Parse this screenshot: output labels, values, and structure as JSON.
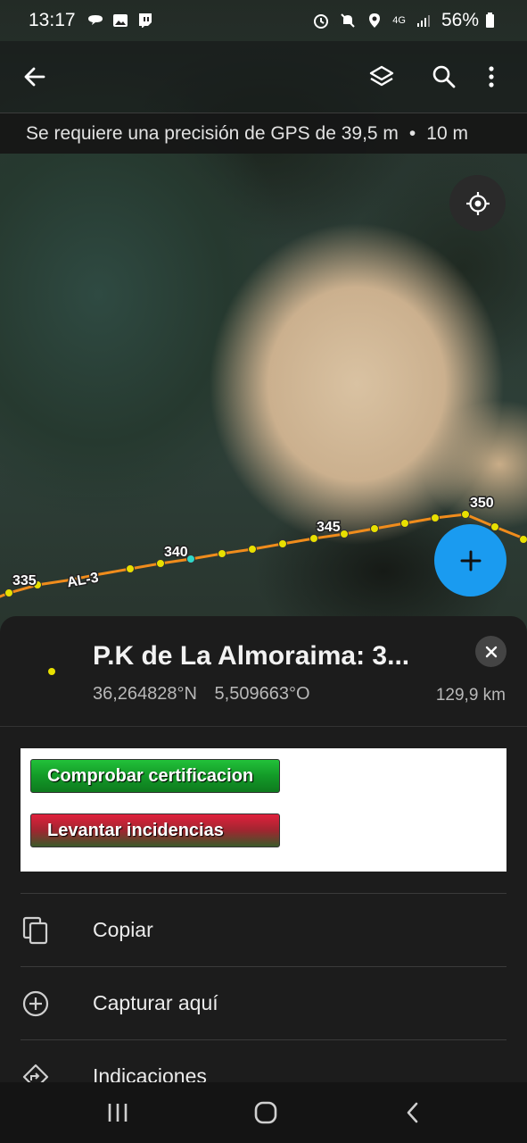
{
  "status_bar": {
    "time": "13:17",
    "battery": "56%",
    "network": "4G",
    "left_icons": [
      "chat-bubble-icon",
      "image-icon",
      "twitch-icon"
    ],
    "right_icons": [
      "alarm-icon",
      "mute-icon",
      "location-icon",
      "network-4g-icon",
      "signal-icon",
      "battery-icon"
    ]
  },
  "toolbar": {
    "icons": [
      "back-arrow-icon",
      "layers-icon",
      "search-icon",
      "more-vert-icon"
    ]
  },
  "gps_banner": {
    "text": "Se requiere una precisión de GPS de 39,5 m",
    "separator": "•",
    "accuracy": "10 m"
  },
  "map": {
    "route_label": "AL-3",
    "km_labels": [
      "335",
      "340",
      "345",
      "350"
    ],
    "route_color": "#f08c1c",
    "point_color": "#e8e000",
    "fab_color": "#1a9bf0"
  },
  "sheet": {
    "title": "P.K de La Almoraima: 3...",
    "latitude": "36,264828°N",
    "longitude": "5,509663°O",
    "distance": "129,9 km",
    "actions": {
      "certify_label": "Comprobar certificacion",
      "incidents_label": "Levantar incidencias"
    },
    "menu": [
      {
        "icon": "copy-icon",
        "label": "Copiar"
      },
      {
        "icon": "add-circle-icon",
        "label": "Capturar aquí"
      },
      {
        "icon": "directions-icon",
        "label": "Indicaciones"
      }
    ]
  },
  "nav_bar": {
    "icons": [
      "recents-icon",
      "home-icon",
      "back-icon"
    ]
  }
}
